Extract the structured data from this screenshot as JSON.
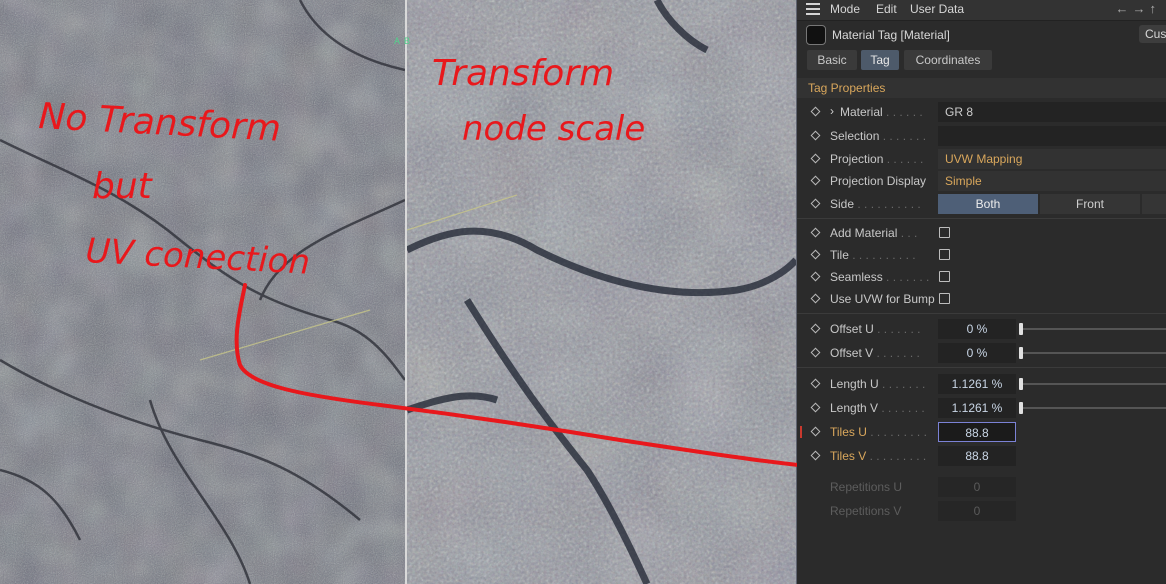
{
  "viewport": {
    "ab_label": "A B",
    "annotations": {
      "left_text": [
        "No Transform",
        "but",
        "UV conection"
      ],
      "right_text": [
        "Transform",
        "node scale"
      ],
      "ink_color": "#e8181c"
    }
  },
  "menubar": {
    "items": [
      "Mode",
      "Edit",
      "User Data"
    ],
    "arrows": "←→↑"
  },
  "tag_header": {
    "title": "Material Tag [Material]",
    "custom_label": "Cus"
  },
  "tabs": [
    {
      "label": "Basic",
      "active": false
    },
    {
      "label": "Tag",
      "active": true
    },
    {
      "label": "Coordinates",
      "active": false
    }
  ],
  "section_title": "Tag Properties",
  "properties": {
    "material": {
      "label": "Material",
      "dots": " . . . . . .",
      "value": "GR 8"
    },
    "selection": {
      "label": "Selection",
      "dots": " . . . . . . .",
      "value": ""
    },
    "projection": {
      "label": "Projection",
      "dots": " . . . . . .",
      "value": "UVW Mapping"
    },
    "projection_display": {
      "label": "Projection Display",
      "value": "Simple"
    },
    "side": {
      "label": "Side",
      "dots": " . . . . . . . . . .",
      "options": [
        "Both",
        "Front",
        ""
      ],
      "selected": "Both"
    },
    "add_material": {
      "label": "Add Material",
      "dots": " . . .",
      "checked": false
    },
    "tile": {
      "label": "Tile",
      "dots": " . . . . . . . . . .",
      "checked": false
    },
    "seamless": {
      "label": "Seamless",
      "dots": " . . . . . . .",
      "checked": false
    },
    "use_uvw_bump": {
      "label": "Use UVW for Bump",
      "checked": false
    },
    "offset_u": {
      "label": "Offset U",
      "dots": " . . . . . . .",
      "value": "0 %",
      "slider": 0.0
    },
    "offset_v": {
      "label": "Offset V",
      "dots": " . . . . . . .",
      "value": "0 %",
      "slider": 0.0
    },
    "length_u": {
      "label": "Length U",
      "dots": " . . . . . . .",
      "value": "1.1261 %",
      "slider": 0.011
    },
    "length_v": {
      "label": "Length V",
      "dots": " . . . . . . .",
      "value": "1.1261 %",
      "slider": 0.011
    },
    "tiles_u": {
      "label": "Tiles U",
      "dots": " . . . . . . . . .",
      "value": "88.8"
    },
    "tiles_v": {
      "label": "Tiles V",
      "dots": " . . . . . . . . .",
      "value": "88.8"
    },
    "repetitions_u": {
      "label": "Repetitions U",
      "value": "0"
    },
    "repetitions_v": {
      "label": "Repetitions V",
      "value": "0"
    }
  },
  "colors": {
    "accent_orange": "#d9a75c",
    "focus_outline": "#7b82d6",
    "active_tab": "#4d5a6a"
  }
}
